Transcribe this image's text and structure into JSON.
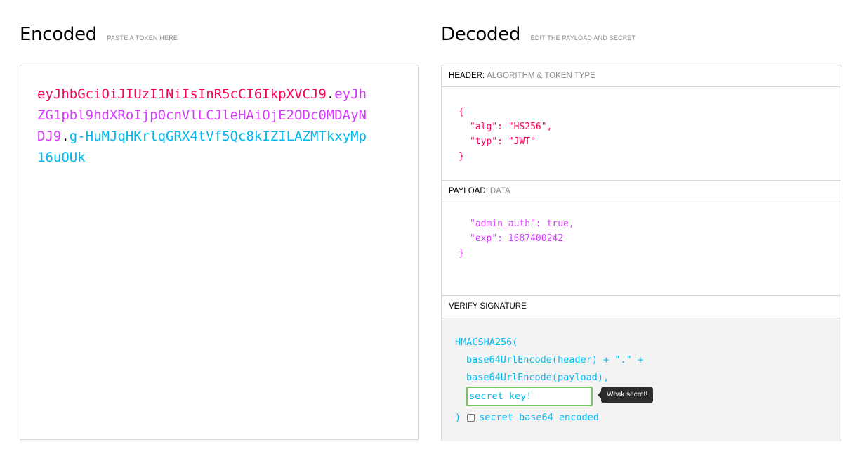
{
  "encoded": {
    "title": "Encoded",
    "subtitle": "PASTE A TOKEN HERE",
    "token_header": "eyJhbGciOiJIUzI1NiIsInR5cCI6IkpXVCJ9",
    "token_payload": "eyJhZG1pbl9hdXRoIjp0cnVlLCJleHAiOjE2ODc0MDAyNDJ9",
    "token_signature": "g-HuMJqHKrlqGRX4tVf5Qc8kIZILAZMTkxyMp16uOUk",
    "dot": ".",
    "colors": {
      "header": "#fb015b",
      "payload": "#d63aff",
      "signature": "#00b9f1"
    }
  },
  "decoded": {
    "title": "Decoded",
    "subtitle": "EDIT THE PAYLOAD AND SECRET",
    "header_section": {
      "label": "HEADER:",
      "desc": "ALGORITHM & TOKEN TYPE",
      "lines": [
        "{",
        "\"alg\": \"HS256\",",
        "\"typ\": \"JWT\"",
        "}"
      ]
    },
    "payload_section": {
      "label": "PAYLOAD:",
      "desc": "DATA",
      "lines": [
        "\"admin_auth\": true,",
        "\"exp\": 1687400242",
        "}"
      ]
    },
    "verify_section": {
      "label": "VERIFY SIGNATURE",
      "fn_open": "HMACSHA256(",
      "line1": "base64UrlEncode(header) + \".\" +",
      "line2": "base64UrlEncode(payload),",
      "secret_value": "secret key!",
      "tooltip": "Weak secret!",
      "fn_close": ")",
      "base64_label": "secret base64 encoded"
    }
  }
}
